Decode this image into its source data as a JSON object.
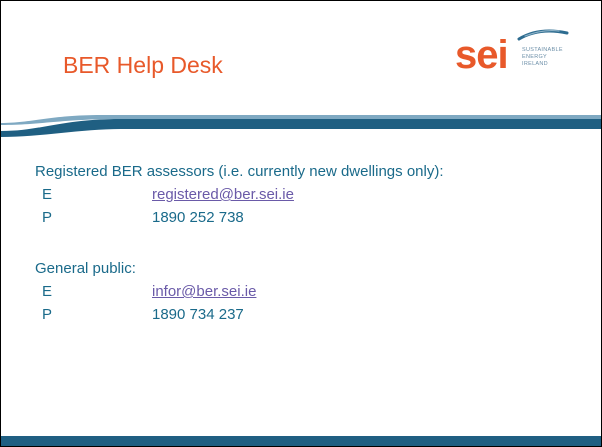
{
  "slide": {
    "title": "BER Help Desk",
    "logo": {
      "wordmark": "sei",
      "tagline": [
        "SUSTAINABLE",
        "ENERGY",
        "IRELAND"
      ],
      "icon": "sei-logo-swoosh"
    },
    "sections": [
      {
        "heading": "Registered BER assessors (i.e. currently new dwellings only):",
        "contacts": [
          {
            "key": "E",
            "value": "registered@ber.sei.ie"
          },
          {
            "key": "P",
            "value": "1890 252 738"
          }
        ]
      },
      {
        "heading": "General public:",
        "contacts": [
          {
            "key": "E",
            "value": "infor@ber.sei.ie"
          },
          {
            "key": "P",
            "value": "1890 734 237"
          }
        ]
      }
    ],
    "colors": {
      "title": "#e8592a",
      "body_text": "#1a6a8a",
      "link": "#6a5aa8",
      "band": "#1f5f82"
    }
  }
}
